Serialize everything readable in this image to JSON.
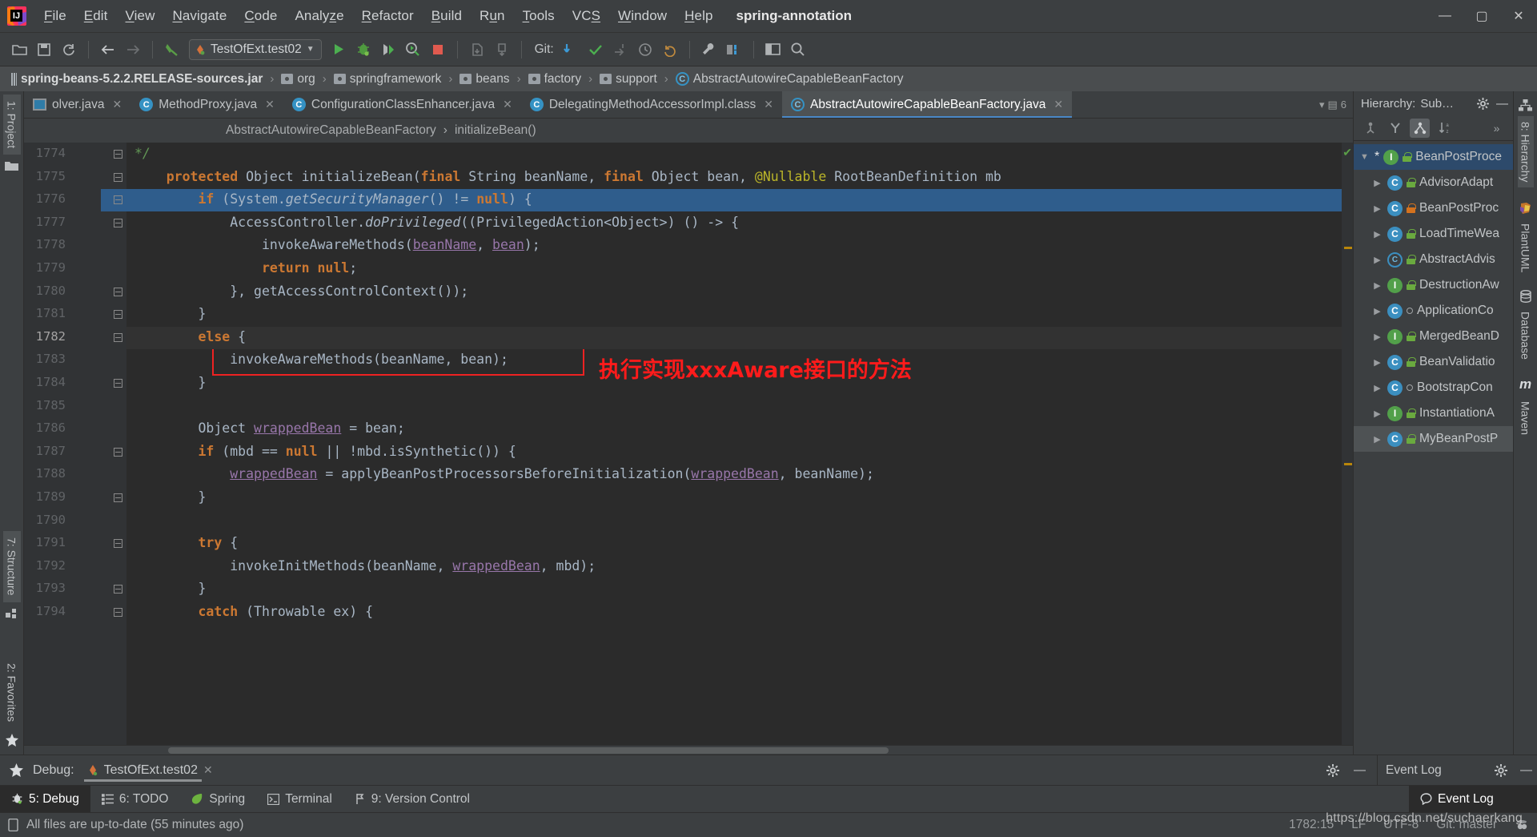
{
  "window": {
    "project_title": "spring-annotation",
    "minimize": "—",
    "maximize": "▢",
    "close": "✕"
  },
  "menubar": {
    "items": [
      "File",
      "Edit",
      "View",
      "Navigate",
      "Code",
      "Analyze",
      "Refactor",
      "Build",
      "Run",
      "Tools",
      "VCS",
      "Window",
      "Help"
    ]
  },
  "toolbar": {
    "run_config": "TestOfExt.test02",
    "git_label": "Git:",
    "icons": [
      "open-folder-icon",
      "save-icon",
      "sync-icon",
      "back-arrow-icon",
      "forward-arrow-icon",
      "build-icon",
      "run-icon",
      "debug-icon",
      "run-coverage-icon",
      "profile-icon",
      "stop-icon",
      "update-project-icon",
      "commit-icon",
      "settings-wrench-icon",
      "project-structure-icon",
      "window-icon",
      "search-icon"
    ]
  },
  "breadcrumb": {
    "items": [
      {
        "label": "spring-beans-5.2.2.RELEASE-sources.jar",
        "icon": "jar-icon"
      },
      {
        "label": "org",
        "icon": "package-icon"
      },
      {
        "label": "springframework",
        "icon": "package-icon"
      },
      {
        "label": "beans",
        "icon": "package-icon"
      },
      {
        "label": "factory",
        "icon": "package-icon"
      },
      {
        "label": "support",
        "icon": "package-icon"
      },
      {
        "label": "AbstractAutowireCapableBeanFactory",
        "icon": "class-icon"
      }
    ]
  },
  "editor_tabs": {
    "tabs": [
      {
        "label": "olver.java",
        "icon": "file-icon",
        "active": false
      },
      {
        "label": "MethodProxy.java",
        "icon": "class-icon",
        "active": false
      },
      {
        "label": "ConfigurationClassEnhancer.java",
        "icon": "class-icon",
        "active": false
      },
      {
        "label": "DelegatingMethodAccessorImpl.class",
        "icon": "class-icon",
        "active": false
      },
      {
        "label": "AbstractAutowireCapableBeanFactory.java",
        "icon": "class-icon",
        "active": true
      }
    ],
    "overflow_count": "6"
  },
  "editor_breadcrumb": {
    "class": "AbstractAutowireCapableBeanFactory",
    "separator": "›",
    "method": "initializeBean()"
  },
  "code": {
    "first_line_number": 1774,
    "highlighted_line": 1776,
    "current_line": 1782,
    "lines": [
      {
        "n": 1774,
        "indent": 1,
        "tokens": [
          {
            "t": "*/",
            "c": "cmt"
          }
        ]
      },
      {
        "n": 1775,
        "indent": 0,
        "tokens": [
          {
            "t": "    ",
            "c": "ident"
          },
          {
            "t": "protected",
            "c": "kwb"
          },
          {
            "t": " Object ",
            "c": "ident"
          },
          {
            "t": "initializeBean",
            "c": "ident"
          },
          {
            "t": "(",
            "c": "ident"
          },
          {
            "t": "final",
            "c": "kwb"
          },
          {
            "t": " String beanName, ",
            "c": "ident"
          },
          {
            "t": "final",
            "c": "kwb"
          },
          {
            "t": " Object bean, ",
            "c": "ident"
          },
          {
            "t": "@Nullable",
            "c": "ann"
          },
          {
            "t": " RootBeanDefinition mb",
            "c": "ident"
          }
        ]
      },
      {
        "n": 1776,
        "indent": 0,
        "tokens": [
          {
            "t": "        ",
            "c": "ident"
          },
          {
            "t": "if",
            "c": "kwb"
          },
          {
            "t": " (System.",
            "c": "ident"
          },
          {
            "t": "getSecurityManager",
            "c": "itl"
          },
          {
            "t": "() != ",
            "c": "ident"
          },
          {
            "t": "null",
            "c": "kwb"
          },
          {
            "t": ") {",
            "c": "ident"
          }
        ]
      },
      {
        "n": 1777,
        "indent": 0,
        "tokens": [
          {
            "t": "            AccessController.",
            "c": "ident"
          },
          {
            "t": "doPrivileged",
            "c": "itl"
          },
          {
            "t": "((PrivilegedAction<Object>) () -> {",
            "c": "ident"
          }
        ]
      },
      {
        "n": 1778,
        "indent": 0,
        "tokens": [
          {
            "t": "                invokeAwareMethods(",
            "c": "ident"
          },
          {
            "t": "beanName",
            "c": "viol"
          },
          {
            "t": ", ",
            "c": "ident"
          },
          {
            "t": "bean",
            "c": "viol"
          },
          {
            "t": ");",
            "c": "ident"
          }
        ]
      },
      {
        "n": 1779,
        "indent": 0,
        "tokens": [
          {
            "t": "                ",
            "c": "ident"
          },
          {
            "t": "return",
            "c": "kwb"
          },
          {
            "t": " ",
            "c": "ident"
          },
          {
            "t": "null",
            "c": "kwb"
          },
          {
            "t": ";",
            "c": "ident"
          }
        ]
      },
      {
        "n": 1780,
        "indent": 0,
        "tokens": [
          {
            "t": "            }, getAccessControlContext());",
            "c": "ident"
          }
        ]
      },
      {
        "n": 1781,
        "indent": 0,
        "tokens": [
          {
            "t": "        }",
            "c": "ident"
          }
        ]
      },
      {
        "n": 1782,
        "indent": 0,
        "tokens": [
          {
            "t": "        ",
            "c": "ident"
          },
          {
            "t": "else",
            "c": "kwb"
          },
          {
            "t": " {",
            "c": "ident"
          }
        ]
      },
      {
        "n": 1783,
        "indent": 0,
        "tokens": [
          {
            "t": "            invokeAwareMethods(beanName, bean);",
            "c": "ident"
          }
        ]
      },
      {
        "n": 1784,
        "indent": 0,
        "tokens": [
          {
            "t": "        }",
            "c": "ident"
          }
        ]
      },
      {
        "n": 1785,
        "indent": 0,
        "tokens": [
          {
            "t": "",
            "c": "ident"
          }
        ]
      },
      {
        "n": 1786,
        "indent": 0,
        "tokens": [
          {
            "t": "        Object ",
            "c": "ident"
          },
          {
            "t": "wrappedBean",
            "c": "viol"
          },
          {
            "t": " = bean;",
            "c": "ident"
          }
        ]
      },
      {
        "n": 1787,
        "indent": 0,
        "tokens": [
          {
            "t": "        ",
            "c": "ident"
          },
          {
            "t": "if",
            "c": "kwb"
          },
          {
            "t": " (mbd == ",
            "c": "ident"
          },
          {
            "t": "null",
            "c": "kwb"
          },
          {
            "t": " || !mbd.isSynthetic()) {",
            "c": "ident"
          }
        ]
      },
      {
        "n": 1788,
        "indent": 0,
        "tokens": [
          {
            "t": "            ",
            "c": "ident"
          },
          {
            "t": "wrappedBean",
            "c": "viol"
          },
          {
            "t": " = applyBeanPostProcessorsBeforeInitialization(",
            "c": "ident"
          },
          {
            "t": "wrappedBean",
            "c": "viol"
          },
          {
            "t": ", beanName);",
            "c": "ident"
          }
        ]
      },
      {
        "n": 1789,
        "indent": 0,
        "tokens": [
          {
            "t": "        }",
            "c": "ident"
          }
        ]
      },
      {
        "n": 1790,
        "indent": 0,
        "tokens": [
          {
            "t": "",
            "c": "ident"
          }
        ]
      },
      {
        "n": 1791,
        "indent": 0,
        "tokens": [
          {
            "t": "        ",
            "c": "ident"
          },
          {
            "t": "try",
            "c": "kwb"
          },
          {
            "t": " {",
            "c": "ident"
          }
        ]
      },
      {
        "n": 1792,
        "indent": 0,
        "tokens": [
          {
            "t": "            invokeInitMethods(beanName, ",
            "c": "ident"
          },
          {
            "t": "wrappedBean",
            "c": "viol"
          },
          {
            "t": ", mbd);",
            "c": "ident"
          }
        ]
      },
      {
        "n": 1793,
        "indent": 0,
        "tokens": [
          {
            "t": "        }",
            "c": "ident"
          }
        ]
      },
      {
        "n": 1794,
        "indent": 0,
        "tokens": [
          {
            "t": "        ",
            "c": "ident"
          },
          {
            "t": "catch",
            "c": "kwb"
          },
          {
            "t": " (Throwable ex) {",
            "c": "ident"
          }
        ]
      }
    ],
    "annotation": {
      "boxed_code": "invokeAwareMethods(beanName, bean);",
      "note": "执行实现xxxAware接口的方法",
      "color": "#ff1b1b"
    }
  },
  "hierarchy": {
    "title": "Hierarchy:",
    "subtitle": "Sub…",
    "gear": "gear-icon",
    "minimize": "—",
    "toolbar_icons": [
      "supertypes-icon",
      "subtypes-icon",
      "class-hierarchy-icon",
      "sort-alpha-icon",
      "more-icon"
    ],
    "more_label": "»",
    "items": [
      {
        "label": "BeanPostProce",
        "kind": "interface",
        "lock": "green",
        "expanded": true,
        "root": true,
        "star": "*",
        "depth": 0
      },
      {
        "label": "AdvisorAdapt",
        "kind": "class",
        "lock": "green",
        "expanded": false,
        "depth": 1
      },
      {
        "label": "BeanPostProc",
        "kind": "class",
        "lock": "orange",
        "expanded": false,
        "depth": 1
      },
      {
        "label": "LoadTimeWea",
        "kind": "class",
        "lock": "green",
        "expanded": false,
        "depth": 1
      },
      {
        "label": "AbstractAdvis",
        "kind": "abstract",
        "lock": "green",
        "expanded": false,
        "depth": 1
      },
      {
        "label": "DestructionAw",
        "kind": "interface",
        "lock": "green",
        "expanded": false,
        "depth": 1
      },
      {
        "label": "ApplicationCo",
        "kind": "class",
        "lock": "none",
        "expanded": false,
        "depth": 1
      },
      {
        "label": "MergedBeanD",
        "kind": "interface",
        "lock": "green",
        "expanded": false,
        "depth": 1
      },
      {
        "label": "BeanValidatio",
        "kind": "class",
        "lock": "green",
        "expanded": false,
        "depth": 1
      },
      {
        "label": "BootstrapCon",
        "kind": "class",
        "lock": "none",
        "expanded": false,
        "depth": 1
      },
      {
        "label": "InstantiationA",
        "kind": "interface",
        "lock": "green",
        "expanded": false,
        "depth": 1
      },
      {
        "label": "MyBeanPostP",
        "kind": "class",
        "lock": "green",
        "expanded": false,
        "depth": 1,
        "selected": true
      }
    ]
  },
  "left_rail": {
    "items": [
      {
        "label": "1: Project",
        "icon": "folder-icon",
        "selected": true
      },
      {
        "label": "7: Structure",
        "icon": "structure-icon",
        "selected": false
      },
      {
        "label": "2: Favorites",
        "icon": "star-icon",
        "selected": false
      }
    ],
    "struct_hint": "Stru"
  },
  "right_rail": {
    "items": [
      {
        "label": "8: Hierarchy",
        "icon": "hierarchy-icon",
        "selected": true
      },
      {
        "label": "PlantUML",
        "icon": "plantuml-icon",
        "selected": false
      },
      {
        "label": "Database",
        "icon": "database-icon",
        "selected": false
      },
      {
        "label": "Maven",
        "icon": "maven-icon",
        "selected": false
      }
    ]
  },
  "debug_panel": {
    "label": "Debug:",
    "session": "TestOfExt.test02",
    "close": "✕",
    "gear": "gear-icon",
    "minimize": "—"
  },
  "event_log": {
    "title": "Event Log",
    "gear": "gear-icon",
    "minimize": "—",
    "tab_label": "Event Log"
  },
  "tool_strip": {
    "items": [
      {
        "label": "5: Debug",
        "icon": "debug-icon",
        "selected": true
      },
      {
        "label": "6: TODO",
        "icon": "todo-icon",
        "selected": false
      },
      {
        "label": "Spring",
        "icon": "spring-leaf-icon",
        "selected": false
      },
      {
        "label": "Terminal",
        "icon": "terminal-icon",
        "selected": false
      },
      {
        "label": "9: Version Control",
        "icon": "vcs-icon",
        "selected": false
      }
    ]
  },
  "statusbar": {
    "message": "All files are up-to-date (55 minutes ago)",
    "caret": "1782:15",
    "line_separator": "LF",
    "encoding": "UTF-8",
    "branch": "Git: master",
    "watermark": "https://blog.csdn.net/suchaerkang"
  }
}
